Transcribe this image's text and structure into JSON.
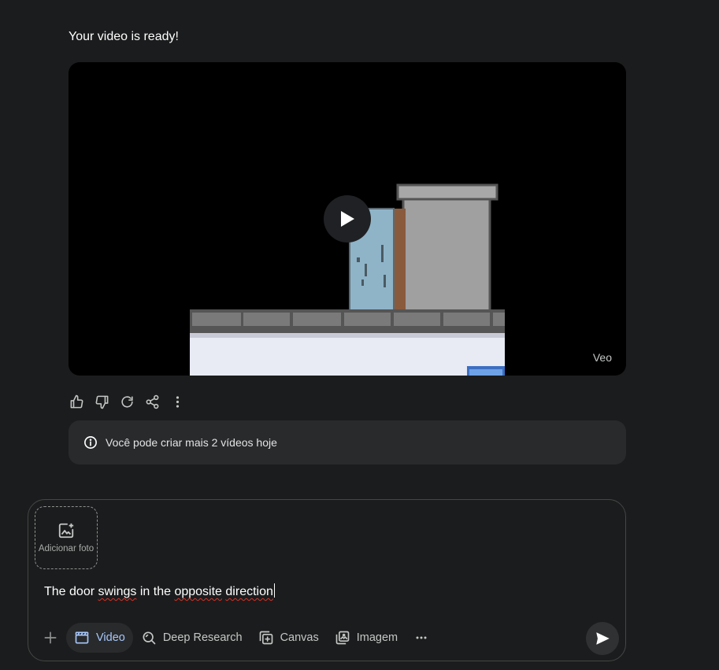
{
  "message": {
    "title": "Your video is ready!"
  },
  "video": {
    "watermark": "Veo"
  },
  "info": {
    "text": "Você pode criar mais 2 vídeos hoje"
  },
  "composer": {
    "add_photo_label": "Adicionar foto",
    "prompt_words": [
      "The door",
      "swings",
      "in the",
      "opposite",
      "direction"
    ],
    "tools": [
      {
        "label": "Video",
        "icon": "clapperboard-icon",
        "active": true
      },
      {
        "label": "Deep Research",
        "icon": "deep-research-icon"
      },
      {
        "label": "Canvas",
        "icon": "canvas-icon"
      },
      {
        "label": "Imagem",
        "icon": "image-icon"
      }
    ]
  },
  "colors": {
    "accent": "#a8c7fa",
    "background": "#1b1c1d",
    "card": "#282a2c"
  }
}
